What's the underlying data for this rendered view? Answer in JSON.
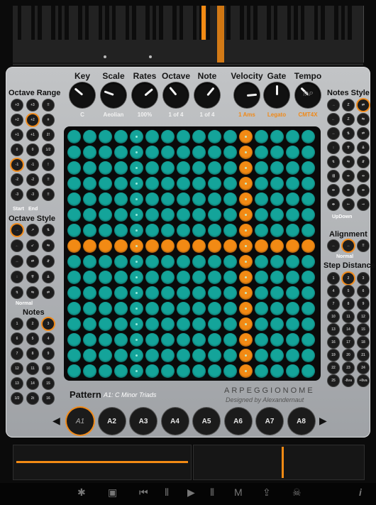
{
  "knobs": [
    {
      "label": "Key",
      "value": "C",
      "angle": -50
    },
    {
      "label": "Scale",
      "value": "Aeolian",
      "angle": -70
    },
    {
      "label": "Rates",
      "value": "100%",
      "angle": 50
    },
    {
      "label": "Octave",
      "value": "1 of 4",
      "angle": -40
    },
    {
      "label": "Note",
      "value": "1 of 4",
      "angle": 40
    },
    {
      "label": "Velocity",
      "value": "1 Ams",
      "angle": 85
    },
    {
      "label": "Gate",
      "value": "Legato",
      "angle": 0
    },
    {
      "label": "Tempo",
      "value": "CMT4X",
      "angle": -45,
      "tap": "TAP"
    }
  ],
  "left": {
    "octave_range": {
      "title": "Octave Range",
      "buttons": [
        "+3",
        "+3",
        "!!",
        "+2",
        "+2",
        "ǂ",
        "+1",
        "+1",
        "2!",
        "0",
        "0",
        "1/2",
        "-1",
        "-1",
        "!",
        "-2",
        "-2",
        "!!",
        "-3",
        "-3",
        "!!"
      ],
      "start_label": "Start",
      "end_label": "End"
    },
    "octave_style": {
      "title": "Octave Style",
      "buttons": [
        "→",
        "↗",
        "⇅",
        "←",
        "↙",
        "⇆",
        "↔",
        "⇄",
        "⇵",
        "↕",
        "⇈",
        "⇊",
        "↯",
        "⇋",
        "⇌"
      ],
      "value": "Normal"
    },
    "notes": {
      "title": "Notes",
      "buttons": [
        "1",
        "2",
        "3",
        "6",
        "5",
        "4",
        "7",
        "8",
        "9",
        "12",
        "11",
        "10",
        "13",
        "14",
        "15",
        "1/2",
        "2t",
        "16"
      ]
    }
  },
  "right": {
    "notes_style": {
      "title": "Notes Style",
      "buttons": [
        "→",
        "Z",
        "⇄",
        "←",
        "Z",
        "⇆",
        "↔",
        "⇅",
        "⇌",
        "↕",
        "⇈",
        "⇊",
        "↯",
        "⇋",
        "⇵",
        "⇶",
        "⇷",
        "⇸",
        "⇹",
        "⇺",
        "⇻",
        "⇼",
        "⇽",
        "⇾"
      ],
      "value": "UpDown"
    },
    "alignment": {
      "title": "Alignment",
      "buttons": [
        "↔",
        "↔",
        "!!"
      ],
      "value": "Normal"
    },
    "step_distance": {
      "title": "Step Distance",
      "buttons": [
        "1",
        "2",
        "3",
        "4",
        "5",
        "6",
        "7",
        "8",
        "9",
        "10",
        "11",
        "12",
        "13",
        "14",
        "15",
        "16",
        "17",
        "18",
        "19",
        "20",
        "21",
        "22",
        "23",
        "24",
        "25",
        "-8va",
        "+8va"
      ]
    }
  },
  "grid": {
    "rows": 16,
    "cols": 16,
    "highlight_row": 7,
    "highlight_col": 11
  },
  "pattern": {
    "label": "Pattern",
    "name": "A1: C Minor Triads",
    "brand": "ARPEGGIONOME",
    "credit": "Designed by Alexandernaut",
    "buttons": [
      "A1",
      "A2",
      "A3",
      "A4",
      "A5",
      "A6",
      "A7",
      "A8"
    ],
    "active": 0
  },
  "toolbar": {
    "icons": [
      "gear-icon",
      "tray-icon",
      "skip-back-icon",
      "bars-icon",
      "play-icon",
      "bars-end-icon",
      "midi-icon",
      "export-icon",
      "skull-icon",
      "info-icon"
    ],
    "glyphs": [
      "✱",
      "▣",
      "⏮",
      "⦀",
      "▶",
      "⦀",
      "M",
      "⇪",
      "☠",
      "i"
    ]
  },
  "accent": "#f28a14",
  "teal": "#14a49a"
}
